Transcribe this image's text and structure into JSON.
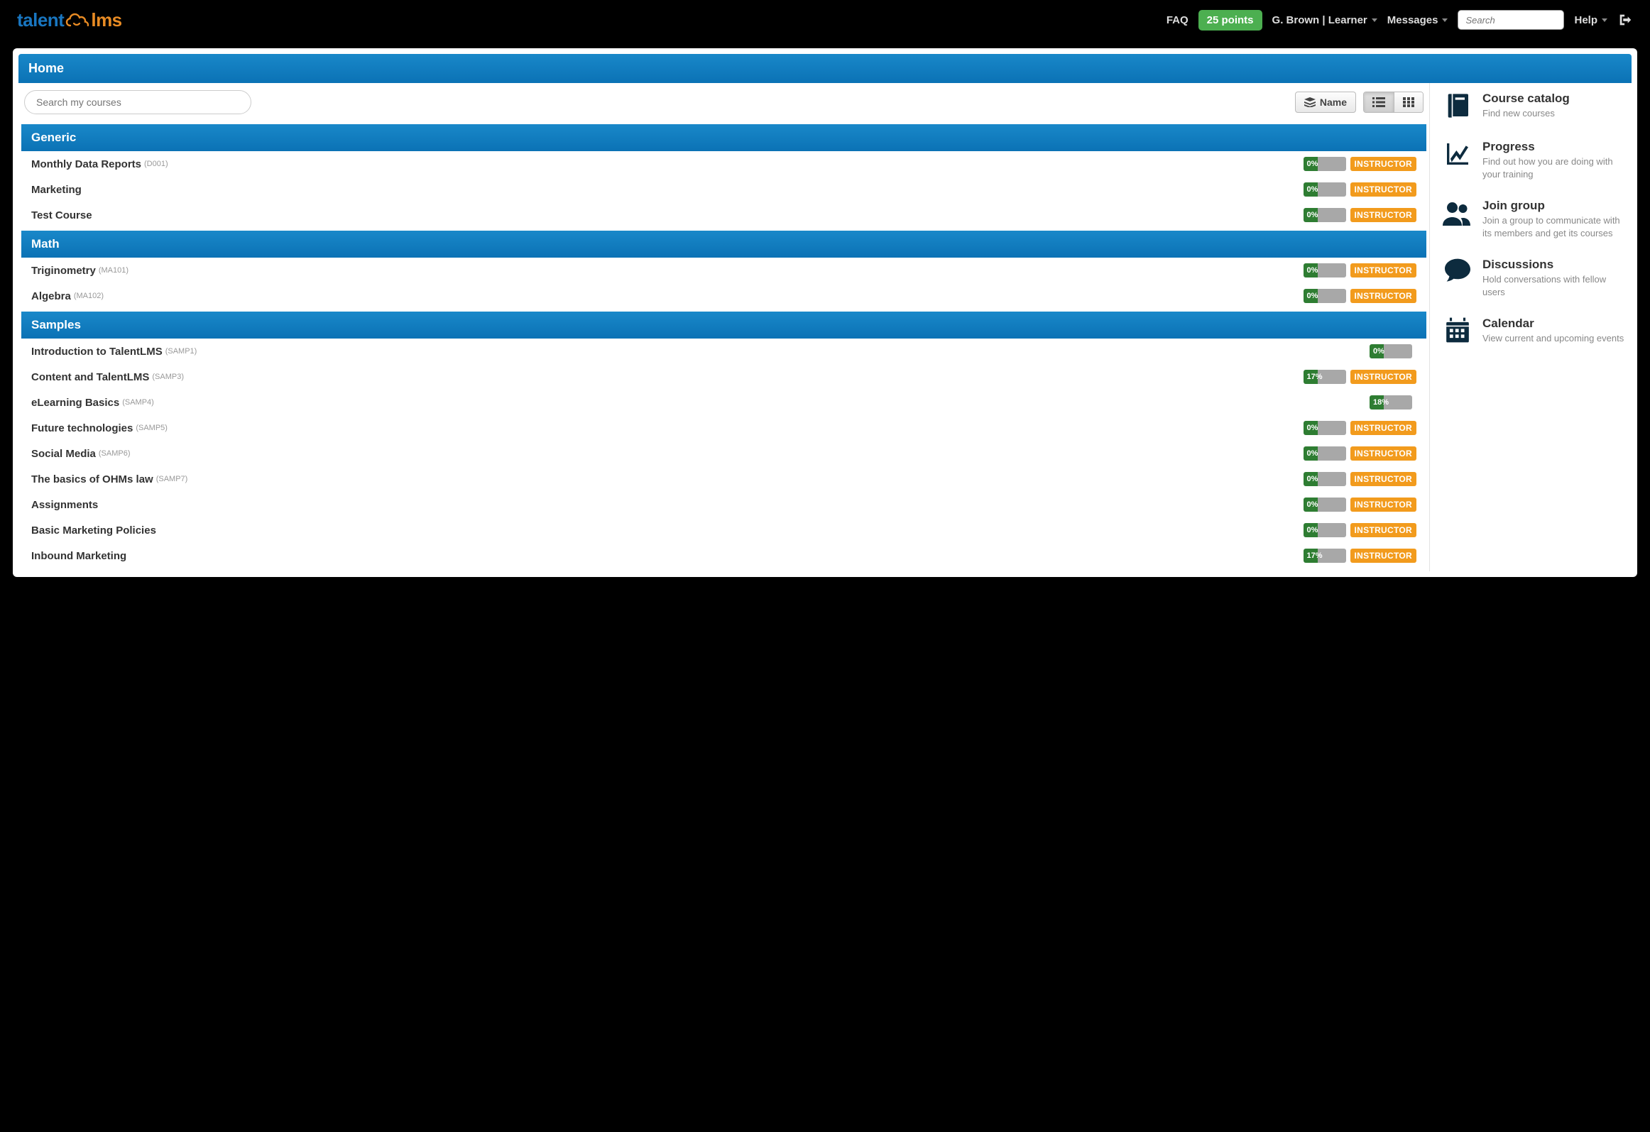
{
  "brand": {
    "part1": "talent",
    "part2": "lms"
  },
  "nav": {
    "faq": "FAQ",
    "points": "25 points",
    "user": "G. Brown | Learner",
    "messages": "Messages",
    "search_placeholder": "Search",
    "help": "Help"
  },
  "page_title": "Home",
  "toolbar": {
    "search_placeholder": "Search my courses",
    "sort_label": "Name"
  },
  "instructor_label": "INSTRUCTOR",
  "categories": [
    {
      "name": "Generic",
      "courses": [
        {
          "title": "Monthly Data Reports",
          "code": "(D001)",
          "progress": 0,
          "instructor": true
        },
        {
          "title": "Marketing",
          "code": "",
          "progress": 0,
          "instructor": true
        },
        {
          "title": "Test Course",
          "code": "",
          "progress": 0,
          "instructor": true
        }
      ]
    },
    {
      "name": "Math",
      "courses": [
        {
          "title": "Triginometry",
          "code": "(MA101)",
          "progress": 0,
          "instructor": true
        },
        {
          "title": "Algebra",
          "code": "(MA102)",
          "progress": 0,
          "instructor": true
        }
      ]
    },
    {
      "name": "Samples",
      "courses": [
        {
          "title": "Introduction to TalentLMS",
          "code": "(SAMP1)",
          "progress": 0,
          "instructor": false
        },
        {
          "title": "Content and TalentLMS",
          "code": "(SAMP3)",
          "progress": 17,
          "instructor": true
        },
        {
          "title": "eLearning Basics",
          "code": "(SAMP4)",
          "progress": 18,
          "instructor": false
        },
        {
          "title": "Future technologies",
          "code": "(SAMP5)",
          "progress": 0,
          "instructor": true
        },
        {
          "title": "Social Media",
          "code": "(SAMP6)",
          "progress": 0,
          "instructor": true
        },
        {
          "title": "The basics of OHMs law",
          "code": "(SAMP7)",
          "progress": 0,
          "instructor": true
        },
        {
          "title": "Assignments",
          "code": "",
          "progress": 0,
          "instructor": true
        },
        {
          "title": "Basic Marketing Policies",
          "code": "",
          "progress": 0,
          "instructor": true
        },
        {
          "title": "Inbound Marketing",
          "code": "",
          "progress": 17,
          "instructor": true
        }
      ]
    }
  ],
  "sidebar": [
    {
      "icon": "book",
      "title": "Course catalog",
      "desc": "Find new courses"
    },
    {
      "icon": "chart",
      "title": "Progress",
      "desc": "Find out how you are doing with your training"
    },
    {
      "icon": "group",
      "title": "Join group",
      "desc": "Join a group to communicate with its members and get its courses"
    },
    {
      "icon": "comment",
      "title": "Discussions",
      "desc": "Hold conversations with fellow users"
    },
    {
      "icon": "calendar",
      "title": "Calendar",
      "desc": "View current and upcoming events"
    }
  ]
}
